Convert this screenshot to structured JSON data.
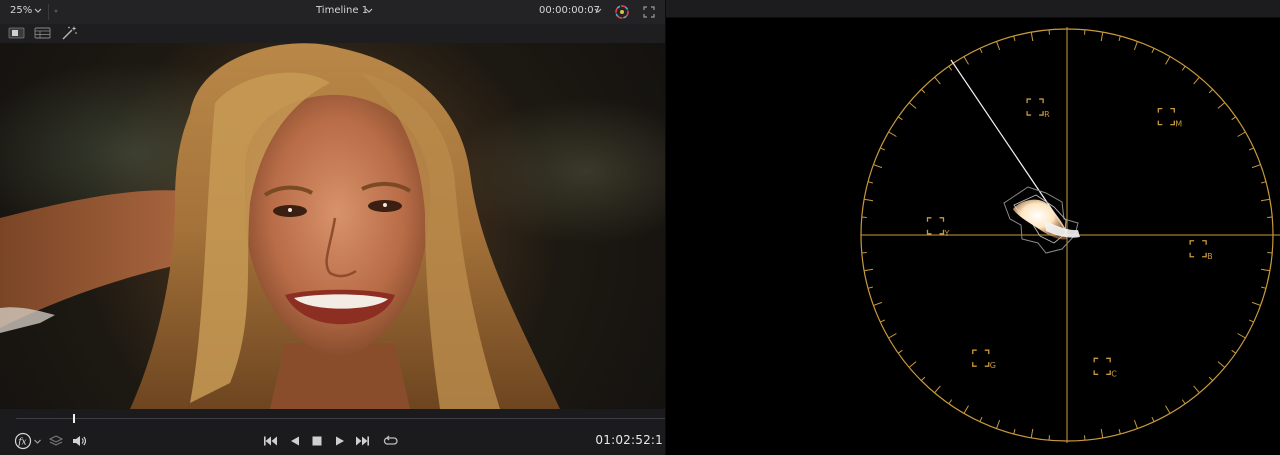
{
  "viewer": {
    "zoom": "25%",
    "timeline_name": "Timeline 1",
    "source_timecode": "00:00:00:07",
    "playback_timecode": "01:02:52:1",
    "playhead_progress": 0.09
  },
  "vectorscope": {
    "targets": [
      {
        "label": "R"
      },
      {
        "label": "M"
      },
      {
        "label": "B"
      },
      {
        "label": "C"
      },
      {
        "label": "G"
      },
      {
        "label": "Y"
      }
    ],
    "graticule_color": "#c89a3c"
  },
  "icons": {
    "zoom_dropdown": "chevron-down-icon",
    "timeline_dropdown": "chevron-down-icon",
    "timecode_dropdown": "chevron-down-icon",
    "color_wheel": "color-wheel-icon",
    "fullscreen": "fullscreen-icon",
    "single_view": "single-viewer-icon",
    "split_view": "split-viewer-icon",
    "magic_wand": "magic-wand-icon",
    "fx": "fx-icon",
    "layers": "layers-icon",
    "volume": "volume-icon",
    "go_to_start": "skip-back-icon",
    "play_reverse": "play-reverse-icon",
    "stop": "stop-icon",
    "play": "play-icon",
    "go_to_end": "skip-forward-icon",
    "loop": "loop-icon"
  }
}
